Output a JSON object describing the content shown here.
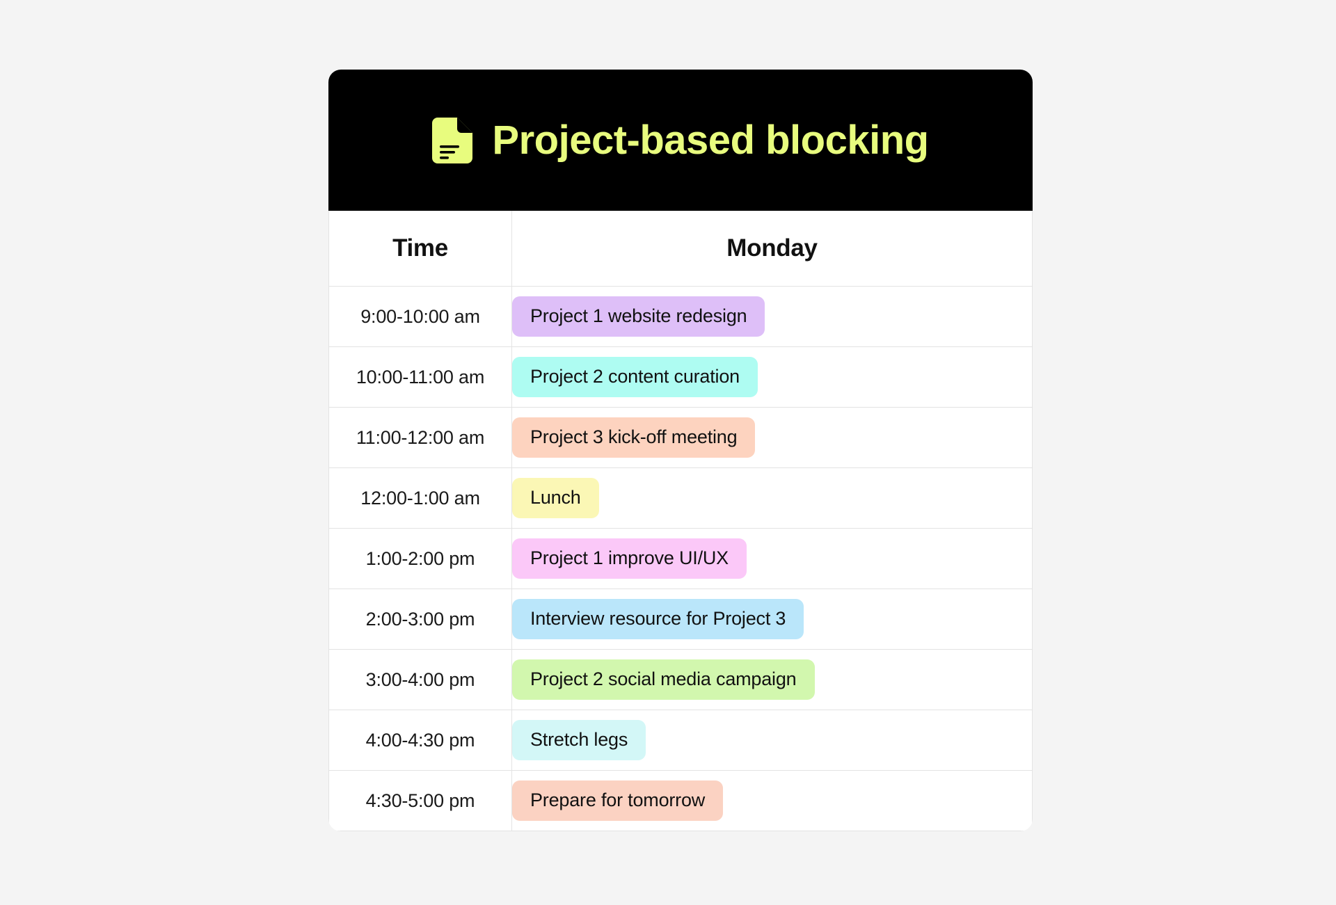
{
  "header": {
    "title": "Project-based blocking",
    "icon": "document-icon",
    "background_color": "#000000",
    "accent_color": "#e8fc7e"
  },
  "table": {
    "columns": [
      "Time",
      "Monday"
    ],
    "rows": [
      {
        "time": "9:00-10:00 am",
        "event": "Project 1 website redesign",
        "color": "#debff8"
      },
      {
        "time": "10:00-11:00 am",
        "event": "Project 2 content curation",
        "color": "#aefcf2"
      },
      {
        "time": "11:00-12:00 am",
        "event": "Project 3 kick-off meeting",
        "color": "#fdd3bf"
      },
      {
        "time": "12:00-1:00 am",
        "event": "Lunch",
        "color": "#fbf7b5"
      },
      {
        "time": "1:00-2:00 pm",
        "event": "Project 1 improve UI/UX",
        "color": "#fbc8f8"
      },
      {
        "time": "2:00-3:00 pm",
        "event": "Interview resource for Project 3",
        "color": "#bae6fa"
      },
      {
        "time": "3:00-4:00 pm",
        "event": "Project 2 social media campaign",
        "color": "#d2f7ae"
      },
      {
        "time": "4:00-4:30 pm",
        "event": "Stretch legs",
        "color": "#d3f7f7"
      },
      {
        "time": "4:30-5:00 pm",
        "event": "Prepare for tomorrow",
        "color": "#fbd2c2"
      }
    ]
  }
}
